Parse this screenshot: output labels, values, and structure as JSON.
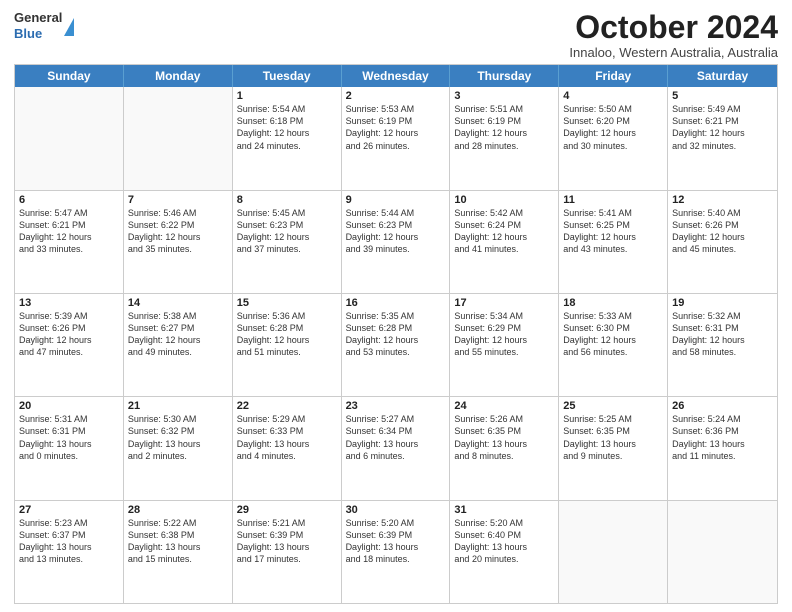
{
  "header": {
    "logo": {
      "line1": "General",
      "line2": "Blue"
    },
    "title": "October 2024",
    "location": "Innaloo, Western Australia, Australia"
  },
  "days": [
    "Sunday",
    "Monday",
    "Tuesday",
    "Wednesday",
    "Thursday",
    "Friday",
    "Saturday"
  ],
  "rows": [
    [
      {
        "day": "",
        "empty": true
      },
      {
        "day": "",
        "empty": true
      },
      {
        "day": "1",
        "line1": "Sunrise: 5:54 AM",
        "line2": "Sunset: 6:18 PM",
        "line3": "Daylight: 12 hours",
        "line4": "and 24 minutes."
      },
      {
        "day": "2",
        "line1": "Sunrise: 5:53 AM",
        "line2": "Sunset: 6:19 PM",
        "line3": "Daylight: 12 hours",
        "line4": "and 26 minutes."
      },
      {
        "day": "3",
        "line1": "Sunrise: 5:51 AM",
        "line2": "Sunset: 6:19 PM",
        "line3": "Daylight: 12 hours",
        "line4": "and 28 minutes."
      },
      {
        "day": "4",
        "line1": "Sunrise: 5:50 AM",
        "line2": "Sunset: 6:20 PM",
        "line3": "Daylight: 12 hours",
        "line4": "and 30 minutes."
      },
      {
        "day": "5",
        "line1": "Sunrise: 5:49 AM",
        "line2": "Sunset: 6:21 PM",
        "line3": "Daylight: 12 hours",
        "line4": "and 32 minutes."
      }
    ],
    [
      {
        "day": "6",
        "line1": "Sunrise: 5:47 AM",
        "line2": "Sunset: 6:21 PM",
        "line3": "Daylight: 12 hours",
        "line4": "and 33 minutes."
      },
      {
        "day": "7",
        "line1": "Sunrise: 5:46 AM",
        "line2": "Sunset: 6:22 PM",
        "line3": "Daylight: 12 hours",
        "line4": "and 35 minutes."
      },
      {
        "day": "8",
        "line1": "Sunrise: 5:45 AM",
        "line2": "Sunset: 6:23 PM",
        "line3": "Daylight: 12 hours",
        "line4": "and 37 minutes."
      },
      {
        "day": "9",
        "line1": "Sunrise: 5:44 AM",
        "line2": "Sunset: 6:23 PM",
        "line3": "Daylight: 12 hours",
        "line4": "and 39 minutes."
      },
      {
        "day": "10",
        "line1": "Sunrise: 5:42 AM",
        "line2": "Sunset: 6:24 PM",
        "line3": "Daylight: 12 hours",
        "line4": "and 41 minutes."
      },
      {
        "day": "11",
        "line1": "Sunrise: 5:41 AM",
        "line2": "Sunset: 6:25 PM",
        "line3": "Daylight: 12 hours",
        "line4": "and 43 minutes."
      },
      {
        "day": "12",
        "line1": "Sunrise: 5:40 AM",
        "line2": "Sunset: 6:26 PM",
        "line3": "Daylight: 12 hours",
        "line4": "and 45 minutes."
      }
    ],
    [
      {
        "day": "13",
        "line1": "Sunrise: 5:39 AM",
        "line2": "Sunset: 6:26 PM",
        "line3": "Daylight: 12 hours",
        "line4": "and 47 minutes."
      },
      {
        "day": "14",
        "line1": "Sunrise: 5:38 AM",
        "line2": "Sunset: 6:27 PM",
        "line3": "Daylight: 12 hours",
        "line4": "and 49 minutes."
      },
      {
        "day": "15",
        "line1": "Sunrise: 5:36 AM",
        "line2": "Sunset: 6:28 PM",
        "line3": "Daylight: 12 hours",
        "line4": "and 51 minutes."
      },
      {
        "day": "16",
        "line1": "Sunrise: 5:35 AM",
        "line2": "Sunset: 6:28 PM",
        "line3": "Daylight: 12 hours",
        "line4": "and 53 minutes."
      },
      {
        "day": "17",
        "line1": "Sunrise: 5:34 AM",
        "line2": "Sunset: 6:29 PM",
        "line3": "Daylight: 12 hours",
        "line4": "and 55 minutes."
      },
      {
        "day": "18",
        "line1": "Sunrise: 5:33 AM",
        "line2": "Sunset: 6:30 PM",
        "line3": "Daylight: 12 hours",
        "line4": "and 56 minutes."
      },
      {
        "day": "19",
        "line1": "Sunrise: 5:32 AM",
        "line2": "Sunset: 6:31 PM",
        "line3": "Daylight: 12 hours",
        "line4": "and 58 minutes."
      }
    ],
    [
      {
        "day": "20",
        "line1": "Sunrise: 5:31 AM",
        "line2": "Sunset: 6:31 PM",
        "line3": "Daylight: 13 hours",
        "line4": "and 0 minutes."
      },
      {
        "day": "21",
        "line1": "Sunrise: 5:30 AM",
        "line2": "Sunset: 6:32 PM",
        "line3": "Daylight: 13 hours",
        "line4": "and 2 minutes."
      },
      {
        "day": "22",
        "line1": "Sunrise: 5:29 AM",
        "line2": "Sunset: 6:33 PM",
        "line3": "Daylight: 13 hours",
        "line4": "and 4 minutes."
      },
      {
        "day": "23",
        "line1": "Sunrise: 5:27 AM",
        "line2": "Sunset: 6:34 PM",
        "line3": "Daylight: 13 hours",
        "line4": "and 6 minutes."
      },
      {
        "day": "24",
        "line1": "Sunrise: 5:26 AM",
        "line2": "Sunset: 6:35 PM",
        "line3": "Daylight: 13 hours",
        "line4": "and 8 minutes."
      },
      {
        "day": "25",
        "line1": "Sunrise: 5:25 AM",
        "line2": "Sunset: 6:35 PM",
        "line3": "Daylight: 13 hours",
        "line4": "and 9 minutes."
      },
      {
        "day": "26",
        "line1": "Sunrise: 5:24 AM",
        "line2": "Sunset: 6:36 PM",
        "line3": "Daylight: 13 hours",
        "line4": "and 11 minutes."
      }
    ],
    [
      {
        "day": "27",
        "line1": "Sunrise: 5:23 AM",
        "line2": "Sunset: 6:37 PM",
        "line3": "Daylight: 13 hours",
        "line4": "and 13 minutes."
      },
      {
        "day": "28",
        "line1": "Sunrise: 5:22 AM",
        "line2": "Sunset: 6:38 PM",
        "line3": "Daylight: 13 hours",
        "line4": "and 15 minutes."
      },
      {
        "day": "29",
        "line1": "Sunrise: 5:21 AM",
        "line2": "Sunset: 6:39 PM",
        "line3": "Daylight: 13 hours",
        "line4": "and 17 minutes."
      },
      {
        "day": "30",
        "line1": "Sunrise: 5:20 AM",
        "line2": "Sunset: 6:39 PM",
        "line3": "Daylight: 13 hours",
        "line4": "and 18 minutes."
      },
      {
        "day": "31",
        "line1": "Sunrise: 5:20 AM",
        "line2": "Sunset: 6:40 PM",
        "line3": "Daylight: 13 hours",
        "line4": "and 20 minutes."
      },
      {
        "day": "",
        "empty": true
      },
      {
        "day": "",
        "empty": true
      }
    ]
  ]
}
